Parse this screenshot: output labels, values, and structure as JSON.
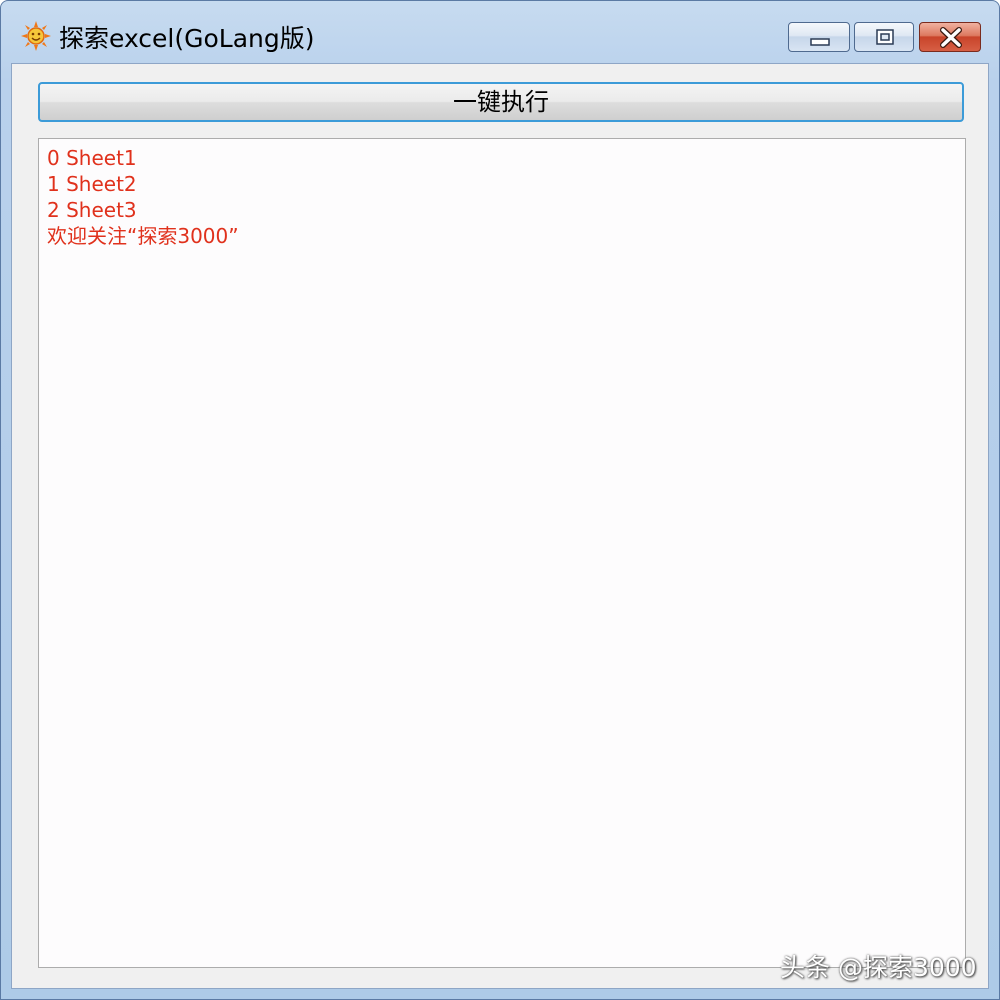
{
  "window": {
    "title": "探索excel(GoLang版)",
    "icon": "sun-face-icon",
    "controls": {
      "minimize": "minimize-icon",
      "maximize": "restore-icon",
      "close": "close-icon"
    }
  },
  "toolbar": {
    "run_label": "一键执行"
  },
  "output": {
    "lines": [
      "0  Sheet1",
      "1  Sheet2",
      "2  Sheet3",
      "欢迎关注“探索3000”"
    ],
    "text_color": "#e0311c"
  },
  "watermark": {
    "text": "头条 @探索3000"
  },
  "colors": {
    "title_bar": "#b9d1ec",
    "button_focus_border": "#3c9bd8",
    "close_button": "#c8442a"
  }
}
